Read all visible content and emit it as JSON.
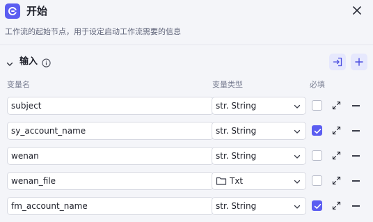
{
  "header": {
    "title": "开始",
    "description": "工作流的起始节点，用于设定启动工作流需要的信息"
  },
  "section": {
    "title": "输入"
  },
  "columns": {
    "name": "变量名",
    "type": "变量类型",
    "required": "必填"
  },
  "rows": [
    {
      "name": "subject",
      "type": "str. String",
      "required": false
    },
    {
      "name": "sy_account_name",
      "type": "str. String",
      "required": true
    },
    {
      "name": "wenan",
      "type": "str. String",
      "required": false
    },
    {
      "name": "wenan_file",
      "type": "Txt",
      "type_icon": "folder-icon",
      "required": false
    },
    {
      "name": "fm_account_name",
      "type": "str. String",
      "required": true
    }
  ],
  "colors": {
    "accent": "#5b5df1",
    "accent_soft": "#e6e8fd",
    "background": "#f4f5f9"
  }
}
